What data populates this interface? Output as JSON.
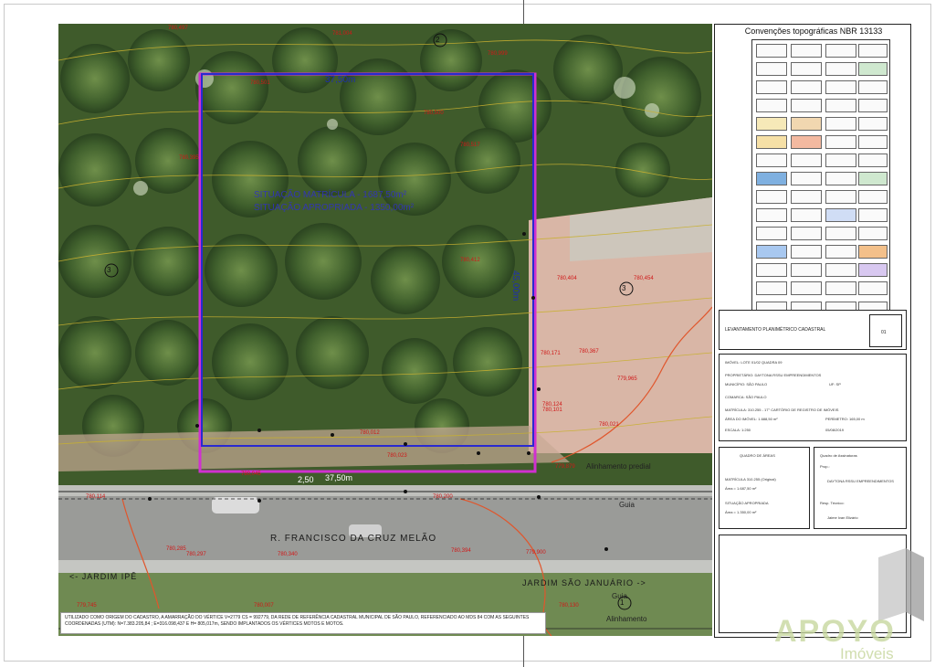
{
  "legend": {
    "title": "Convenções topográficas NBR 13133"
  },
  "map": {
    "plot_width_label": "37,50m",
    "plot_bottom_label": "37,50m",
    "plot_side_label": "45,00m",
    "setback_label": "2,50",
    "area_line1": "SITUAÇÃO MATRÍCULA - 1687,50m²",
    "area_line2": "SITUAÇÃO APROPRIADA - 1350,00m²",
    "street_name": "R. FRANCISCO DA CRUZ MELÃO",
    "neighborhood_left": "<-  JARDIM IPÊ",
    "neighborhood_right": "JARDIM SÃO JANUÁRIO ->",
    "alignment_label_top": "Alinhamento predial",
    "alignment_label_bottom": "Alinhamento",
    "guia_label_top": "Guia",
    "guia_label_bottom": "Guia",
    "marker_labels": [
      "2",
      "3",
      "3",
      "1"
    ],
    "elevations": [
      "780,497",
      "781,004",
      "780,999",
      "780,501",
      "780,500",
      "780,454",
      "780,395",
      "780,517",
      "780,404",
      "780,412",
      "780,367",
      "780,171",
      "780,124",
      "780,101",
      "780,021",
      "780,012",
      "779,965",
      "779,879",
      "780,045",
      "780,023",
      "780,114",
      "780,200",
      "780,285",
      "780,297",
      "780,340",
      "780,394",
      "779,900",
      "779,745",
      "780,007",
      "780,130"
    ],
    "note_text": "UTILIZADO COMO ORIGEM DO CADASTRO, A AMARRAÇÃO DO VÉRTICE V=2779 CS = 992779, DA REDE DE REFERÊNCIA CADASTRAL MUNICIPAL DE SÃO PAULO, REFERENCIADO AO MDS 84 COM AS SEGUINTES COORDENADAS (UTM): N=7.383.205,84 ; E=316.098,437 E H= 805,017m, SENDO IMPLANTADOS OS VÉRTICES MOTOS E MOTOS."
  },
  "title_block": {
    "doc_title": "LEVANTAMENTO PLANIMÉTRICO CADASTRAL",
    "sheet": "01",
    "imovel": "IMÓVEL: LOTE 01/02 QUADRA 09",
    "proprietario": "PROPRIETÁRIO: DAYTONA RSSU EMPREENDIMENTOS",
    "municipio": "MUNICÍPIO: SÃO PAULO",
    "uf": "UF: SP",
    "comarca": "COMARCA: SÃO PAULO",
    "matricula": "MATRÍCULA: 310.255 - 17° CARTÓRIO DE REGISTRO DE IMÓVEIS",
    "area": "ÁREA DO IMÓVEL: 1.688,50 m²",
    "perimetro": "PERÍMETRO: 165,00 m",
    "escala": "ESCALA: 1:250",
    "data": "05/08/2019"
  },
  "areas": {
    "title": "QUADRO DE ÁREAS",
    "matricula_label": "MATRÍCULA 310.255 (Original)",
    "matricula_value": "Área = 1.687,50 m²",
    "apropriada_label": "SITUAÇÃO APROPRIADA",
    "apropriada_value": "Área = 1.350,00 m²"
  },
  "signatures": {
    "title": "Quadro de Assinaturas",
    "prop_label": "Prop.:",
    "prop_name": "DAYTONA RSSU EMPREENDIMENTOS",
    "tec_label": "Resp. Técnico:",
    "tec_name": "Jaime Ivan Elizário"
  },
  "brand": {
    "name": "APOYO",
    "sub": "Imóveis"
  }
}
